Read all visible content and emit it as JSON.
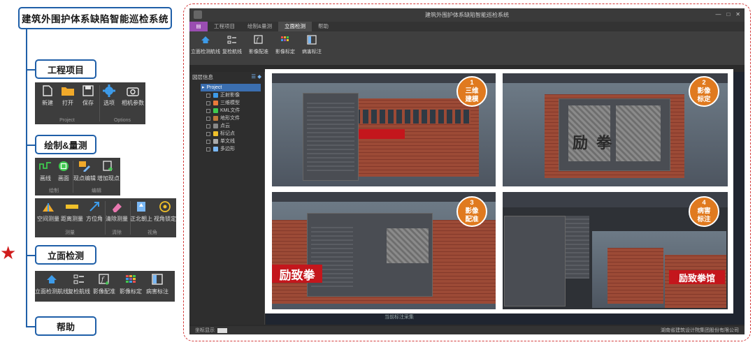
{
  "system_title": "建筑外围护体系缺陷智能巡检系统",
  "categories": {
    "project": "工程项目",
    "draw": "绘制&量测",
    "facade": "立面检测",
    "help": "帮助"
  },
  "ribbon_project": {
    "buttons": [
      "新建",
      "打开",
      "保存",
      "选项",
      "相机参数"
    ],
    "groups": [
      "Project",
      "Options"
    ]
  },
  "ribbon_draw": {
    "buttons": [
      "画线",
      "画面",
      "现点编辑",
      "增加现点"
    ],
    "groups": [
      "绘制",
      "编辑"
    ]
  },
  "ribbon_measure": {
    "buttons": [
      "空间测量",
      "距离测量",
      "方位角",
      "清除测量",
      "正北朝上",
      "视角锁定"
    ],
    "groups": [
      "测量",
      "清除",
      "视角"
    ]
  },
  "ribbon_facade": {
    "buttons": [
      "立面检测航线",
      "复检航线",
      "影像配准",
      "影像标定",
      "病害标注"
    ]
  },
  "app": {
    "window_title": "建筑外围护体系缺陷智能巡检系统",
    "tabs": [
      "工程项目",
      "绘制&量测",
      "立面检测",
      "帮助"
    ],
    "active_tab": "立面检测",
    "ribbon_buttons": [
      "立面检测航线",
      "复检航线",
      "影像配准",
      "影像标定",
      "病害标注"
    ],
    "panel_title": "図层信息",
    "tree": {
      "root": "Project",
      "items": [
        "正射影像",
        "三维模型",
        "KML文件",
        "地形文件",
        "点云",
        "标记点",
        "单文线",
        "多边形"
      ]
    },
    "status_left": "坐标显示",
    "status_right": "湖南省建筑设计院集团股份有限公司",
    "bottom_hint": "当前标注采集"
  },
  "steps": [
    {
      "num": "1",
      "lines": [
        "三维",
        "建模"
      ]
    },
    {
      "num": "2",
      "lines": [
        "影像",
        "标定"
      ]
    },
    {
      "num": "3",
      "lines": [
        "影像",
        "配准"
      ]
    },
    {
      "num": "4",
      "lines": [
        "病害",
        "标注"
      ]
    }
  ],
  "shop_signs": {
    "sign3": "励致拳",
    "sign4": "励致拳馆",
    "calib": "励拳"
  },
  "colors": {
    "accent_blue": "#1f5fa8",
    "star_red": "#d01c1c",
    "frame_red": "#d43a3a",
    "badge_orange": "#e07a1f",
    "file_tab_purple": "#9a4db1"
  }
}
